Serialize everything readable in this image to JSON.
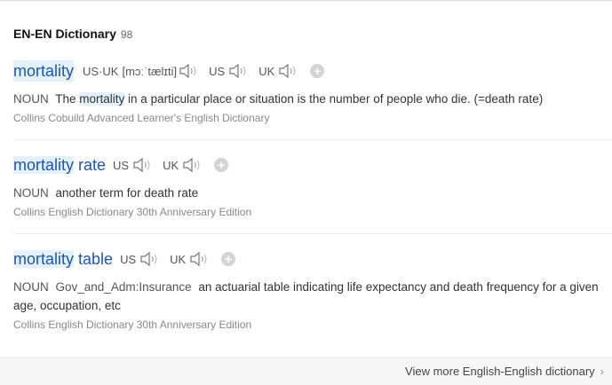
{
  "header": {
    "title": "EN-EN Dictionary",
    "count": "98"
  },
  "entries": [
    {
      "word": "mortality",
      "pron_label": "US·UK",
      "phonetic": "[mɔːˈtælɪti]",
      "us": "US",
      "uk": "UK",
      "pos": "NOUN",
      "def_pre": "The ",
      "def_hl": "mortality",
      "def_post": " in a particular place or situation is the number of people who die. (=death rate)",
      "source": "Collins Cobuild Advanced Learner's English Dictionary"
    },
    {
      "word_hl": "mortality",
      "word_rest": " rate",
      "us": "US",
      "uk": "UK",
      "pos": "NOUN",
      "definition": "another term for death rate",
      "source": "Collins English Dictionary 30th Anniversary Edition"
    },
    {
      "word_hl": "mortality",
      "word_rest": " table",
      "us": "US",
      "uk": "UK",
      "pos": "NOUN",
      "domain": "Gov_and_Adm:Insurance",
      "definition": "an actuarial table indicating life expectancy and death frequency for a given age, occupation, etc",
      "source": "Collins English Dictionary 30th Anniversary Edition"
    }
  ],
  "footer": {
    "more": "View more English-English dictionary"
  },
  "icons": {
    "speaker": "speaker-icon",
    "add": "plus-circle-icon",
    "chevron": "chevron-right-icon"
  }
}
